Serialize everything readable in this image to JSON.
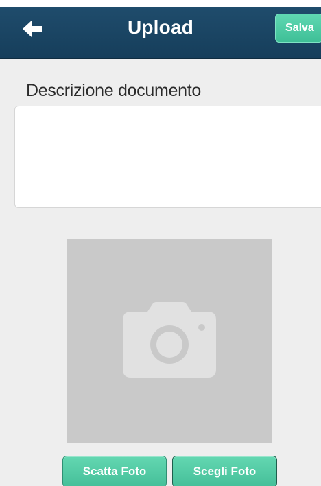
{
  "header": {
    "title": "Upload",
    "back_icon": "arrow-left-icon",
    "save_label": "Salva"
  },
  "form": {
    "description_label": "Descrizione documento",
    "description_value": "",
    "description_placeholder": ""
  },
  "photo": {
    "placeholder_icon": "camera-icon"
  },
  "actions": {
    "take_photo_label": "Scatta Foto",
    "choose_photo_label": "Scegli Foto"
  },
  "colors": {
    "header_bg": "#1d4866",
    "accent": "#4cc9a2",
    "background": "#eeeeee",
    "photo_placeholder_bg": "#c9c9c9"
  }
}
